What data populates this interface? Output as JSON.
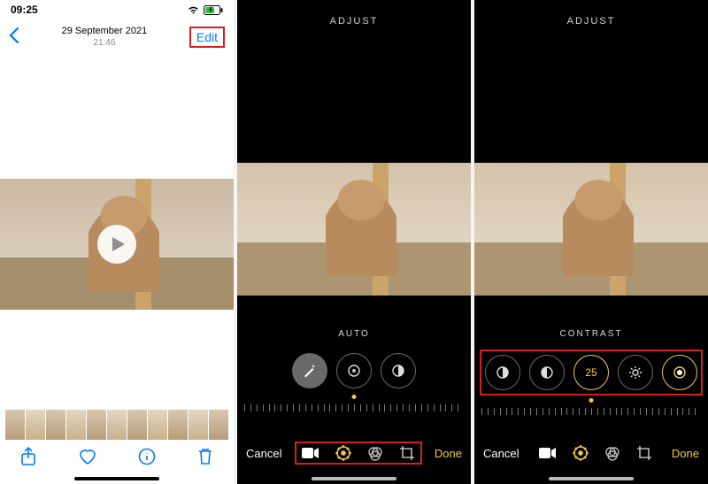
{
  "screen1": {
    "status": {
      "time": "09:25"
    },
    "nav": {
      "date": "29 September 2021",
      "time": "21:46",
      "edit_label": "Edit"
    }
  },
  "screen2": {
    "header": "ADJUST",
    "tool_label": "AUTO",
    "bottom": {
      "cancel": "Cancel",
      "done": "Done"
    }
  },
  "screen3": {
    "header": "ADJUST",
    "tool_label": "CONTRAST",
    "value": "25",
    "bottom": {
      "cancel": "Cancel",
      "done": "Done"
    }
  }
}
